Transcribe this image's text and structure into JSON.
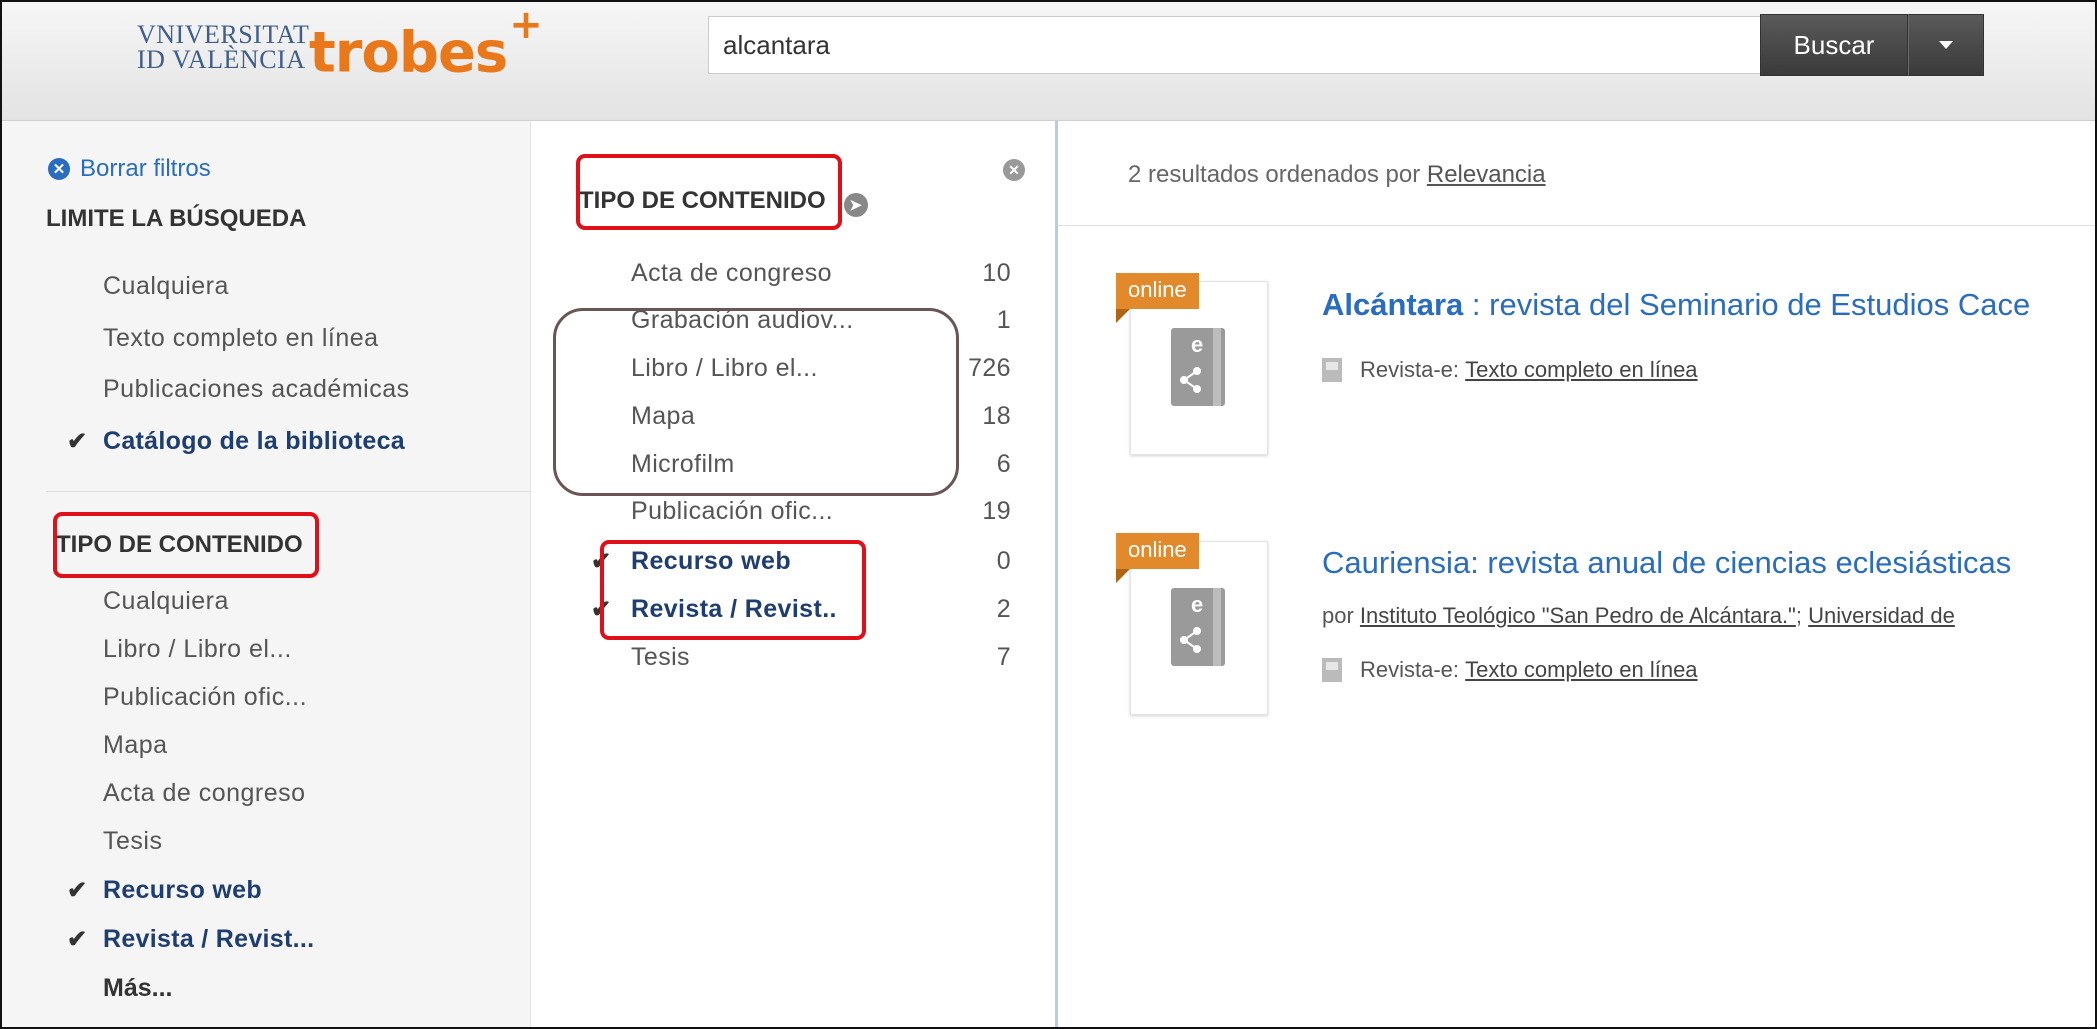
{
  "header": {
    "logo": {
      "university_line1": "VNIVERSITAT",
      "university_line2": "ID VALÈNCIA",
      "brand": "trobes",
      "brand_plus": "+"
    },
    "search": {
      "value": "alcantara"
    },
    "search_button_label": "Buscar"
  },
  "sidebar": {
    "clear_filters_label": "Borrar filtros",
    "limit_title": "LIMITE LA BÚSQUEDA",
    "limit_items": [
      {
        "label": "Cualquiera",
        "checked": false
      },
      {
        "label": "Texto completo en línea",
        "checked": false
      },
      {
        "label": "Publicaciones académicas",
        "checked": false
      },
      {
        "label": "Catálogo de la biblioteca",
        "checked": true
      }
    ],
    "content_type_title": "TIPO DE CONTENIDO",
    "content_type_items": [
      {
        "label": "Cualquiera",
        "checked": false
      },
      {
        "label": "Libro / Libro el...",
        "checked": false
      },
      {
        "label": "Publicación ofic...",
        "checked": false
      },
      {
        "label": "Mapa",
        "checked": false
      },
      {
        "label": "Acta de congreso",
        "checked": false
      },
      {
        "label": "Tesis",
        "checked": false
      },
      {
        "label": "Recurso web",
        "checked": true
      },
      {
        "label": "Revista / Revist...",
        "checked": true
      }
    ],
    "more_label": "Más..."
  },
  "facet_panel": {
    "title": "TIPO DE CONTENIDO",
    "items": [
      {
        "label": "Acta de congreso",
        "count": "10",
        "checked": false
      },
      {
        "label": "Grabación audiov...",
        "count": "1",
        "checked": false
      },
      {
        "label": "Libro / Libro el...",
        "count": "726",
        "checked": false
      },
      {
        "label": "Mapa",
        "count": "18",
        "checked": false
      },
      {
        "label": "Microfilm",
        "count": "6",
        "checked": false
      },
      {
        "label": "Publicación ofic...",
        "count": "19",
        "checked": false
      },
      {
        "label": "Recurso web",
        "count": "0",
        "checked": true
      },
      {
        "label": "Revista / Revist..",
        "count": "2",
        "checked": true
      },
      {
        "label": "Tesis",
        "count": "7",
        "checked": false
      }
    ]
  },
  "results": {
    "summary_prefix": "2 resultados ordenados por",
    "sort_link": "Relevancia",
    "items": [
      {
        "badge": "online",
        "title_bold": "Alcántara",
        "title_rest": " : revista del Seminario de Estudios Cace",
        "format_prefix": "Revista-e:",
        "format_link": "Texto completo en línea"
      },
      {
        "badge": "online",
        "title_bold": "",
        "title_rest": "Cauriensia: revista anual de ciencias eclesiásticas",
        "author_prefix": "por",
        "author_link": "Instituto Teológico \"San Pedro de Alcántara.\"",
        "author_sep": ";",
        "author_link2": "Universidad de",
        "format_prefix": "Revista-e:",
        "format_link": "Texto completo en línea"
      }
    ]
  },
  "colors": {
    "accent_blue": "#2a6cbf",
    "checked_navy": "#1f3e70",
    "brand_orange": "#e8781a",
    "annotation_red": "#e0101a",
    "annotation_brown": "#6a5555"
  }
}
